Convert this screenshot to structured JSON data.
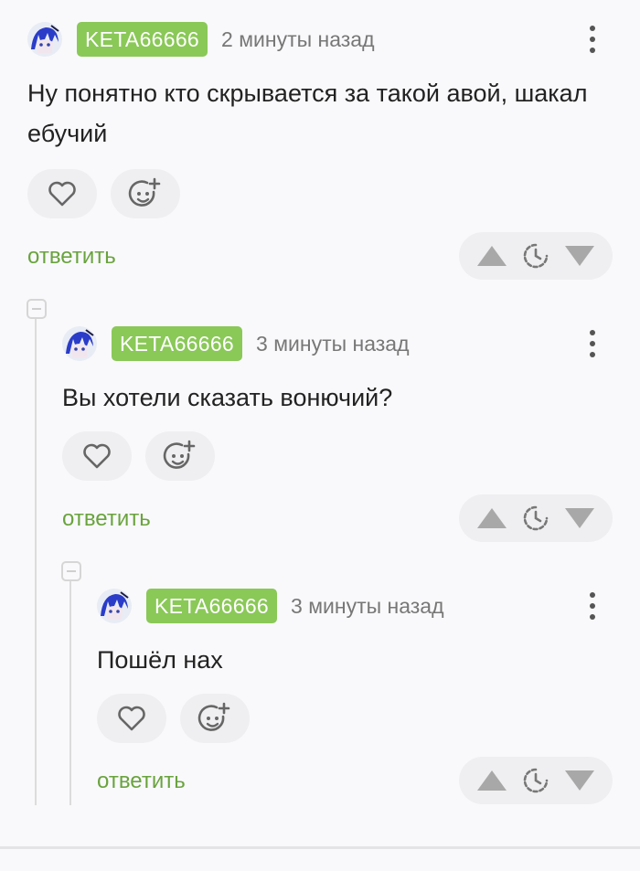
{
  "comments": [
    {
      "username": "KETA66666",
      "time": "2 минуты назад",
      "text": "Ну понятно кто скрывается за такой авой, шакал ебучий",
      "reply_label": "ответить"
    },
    {
      "username": "KETA66666",
      "time": "3 минуты назад",
      "text": "Вы хотели сказать вонючий?",
      "reply_label": "ответить"
    },
    {
      "username": "KETA66666",
      "time": "3 минуты назад",
      "text": "Пошёл нах",
      "reply_label": "ответить"
    }
  ],
  "icons": {
    "like": "heart-icon",
    "reaction": "add-emoji-icon",
    "upvote": "arrow-up-icon",
    "save": "clock-icon",
    "downvote": "arrow-down-icon",
    "more": "more-vertical-icon",
    "collapse": "collapse-icon"
  },
  "colors": {
    "username_badge": "#8ac858",
    "reply_link": "#6aa33e",
    "background": "#f9f9fb"
  }
}
